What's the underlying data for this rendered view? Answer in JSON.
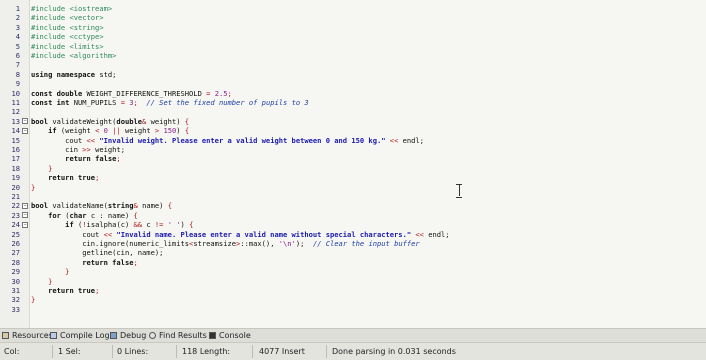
{
  "editor": {
    "lines": [
      {
        "n": "1",
        "fold": "",
        "segs": [
          {
            "c": "dir",
            "t": "#include "
          },
          {
            "c": "inc",
            "t": "<iostream>"
          }
        ]
      },
      {
        "n": "2",
        "fold": "",
        "segs": [
          {
            "c": "dir",
            "t": "#include "
          },
          {
            "c": "inc",
            "t": "<vector>"
          }
        ]
      },
      {
        "n": "3",
        "fold": "",
        "segs": [
          {
            "c": "dir",
            "t": "#include "
          },
          {
            "c": "inc",
            "t": "<string>"
          }
        ]
      },
      {
        "n": "4",
        "fold": "",
        "segs": [
          {
            "c": "dir",
            "t": "#include "
          },
          {
            "c": "inc",
            "t": "<cctype>"
          }
        ]
      },
      {
        "n": "5",
        "fold": "",
        "segs": [
          {
            "c": "dir",
            "t": "#include "
          },
          {
            "c": "inc",
            "t": "<limits>"
          }
        ]
      },
      {
        "n": "6",
        "fold": "",
        "segs": [
          {
            "c": "dir",
            "t": "#include "
          },
          {
            "c": "inc",
            "t": "<algorithm>"
          }
        ]
      },
      {
        "n": "7",
        "fold": "",
        "segs": []
      },
      {
        "n": "8",
        "fold": "",
        "segs": [
          {
            "c": "kw",
            "t": "using namespace "
          },
          {
            "c": "txt",
            "t": "std;"
          }
        ]
      },
      {
        "n": "9",
        "fold": "",
        "segs": []
      },
      {
        "n": "10",
        "fold": "",
        "segs": [
          {
            "c": "kw",
            "t": "const double "
          },
          {
            "c": "txt",
            "t": "WEIGHT_DIFFERENCE_THRESHOLD "
          },
          {
            "c": "sym",
            "t": "="
          },
          {
            "c": "txt",
            "t": " "
          },
          {
            "c": "num",
            "t": "2.5"
          },
          {
            "c": "sym",
            "t": ";"
          }
        ]
      },
      {
        "n": "11",
        "fold": "",
        "segs": [
          {
            "c": "kw",
            "t": "const int "
          },
          {
            "c": "txt",
            "t": "NUM_PUPILS "
          },
          {
            "c": "sym",
            "t": "="
          },
          {
            "c": "txt",
            "t": " "
          },
          {
            "c": "num",
            "t": "3"
          },
          {
            "c": "sym",
            "t": ";"
          },
          {
            "c": "txt",
            "t": "  "
          },
          {
            "c": "cmt",
            "t": "// Set the fixed number of pupils to 3"
          }
        ]
      },
      {
        "n": "12",
        "fold": "",
        "segs": []
      },
      {
        "n": "13",
        "fold": "−",
        "segs": [
          {
            "c": "kw",
            "t": "bool "
          },
          {
            "c": "txt",
            "t": "validateWeight("
          },
          {
            "c": "kw",
            "t": "double"
          },
          {
            "c": "sym",
            "t": "&"
          },
          {
            "c": "txt",
            "t": " weight) "
          },
          {
            "c": "sym",
            "t": "{"
          }
        ]
      },
      {
        "n": "14",
        "fold": "−",
        "segs": [
          {
            "c": "txt",
            "t": "    "
          },
          {
            "c": "kw",
            "t": "if "
          },
          {
            "c": "txt",
            "t": "(weight "
          },
          {
            "c": "sym",
            "t": "<"
          },
          {
            "c": "txt",
            "t": " "
          },
          {
            "c": "num",
            "t": "0"
          },
          {
            "c": "txt",
            "t": " "
          },
          {
            "c": "sym",
            "t": "||"
          },
          {
            "c": "txt",
            "t": " weight "
          },
          {
            "c": "sym",
            "t": ">"
          },
          {
            "c": "txt",
            "t": " "
          },
          {
            "c": "num",
            "t": "150"
          },
          {
            "c": "txt",
            "t": ") "
          },
          {
            "c": "sym",
            "t": "{"
          }
        ]
      },
      {
        "n": "15",
        "fold": "",
        "segs": [
          {
            "c": "txt",
            "t": "        cout "
          },
          {
            "c": "sym",
            "t": "<<"
          },
          {
            "c": "txt",
            "t": " "
          },
          {
            "c": "str",
            "t": "\"Invalid weight. Please enter a valid weight between 0 and 150 kg.\""
          },
          {
            "c": "txt",
            "t": " "
          },
          {
            "c": "sym",
            "t": "<<"
          },
          {
            "c": "txt",
            "t": " endl;"
          }
        ]
      },
      {
        "n": "16",
        "fold": "",
        "segs": [
          {
            "c": "txt",
            "t": "        cin "
          },
          {
            "c": "sym",
            "t": ">>"
          },
          {
            "c": "txt",
            "t": " weight;"
          }
        ]
      },
      {
        "n": "17",
        "fold": "",
        "segs": [
          {
            "c": "txt",
            "t": "        "
          },
          {
            "c": "kw",
            "t": "return false"
          },
          {
            "c": "sym",
            "t": ";"
          }
        ]
      },
      {
        "n": "18",
        "fold": "",
        "segs": [
          {
            "c": "txt",
            "t": "    "
          },
          {
            "c": "sym",
            "t": "}"
          }
        ]
      },
      {
        "n": "19",
        "fold": "",
        "segs": [
          {
            "c": "txt",
            "t": "    "
          },
          {
            "c": "kw",
            "t": "return true"
          },
          {
            "c": "sym",
            "t": ";"
          }
        ]
      },
      {
        "n": "20",
        "fold": "",
        "segs": [
          {
            "c": "sym",
            "t": "}"
          }
        ]
      },
      {
        "n": "21",
        "fold": "",
        "segs": []
      },
      {
        "n": "22",
        "fold": "−",
        "segs": [
          {
            "c": "kw",
            "t": "bool "
          },
          {
            "c": "txt",
            "t": "validateName("
          },
          {
            "c": "kw",
            "t": "string"
          },
          {
            "c": "sym",
            "t": "&"
          },
          {
            "c": "txt",
            "t": " name) "
          },
          {
            "c": "sym",
            "t": "{"
          }
        ]
      },
      {
        "n": "23",
        "fold": "−",
        "segs": [
          {
            "c": "txt",
            "t": "    "
          },
          {
            "c": "kw",
            "t": "for "
          },
          {
            "c": "txt",
            "t": "("
          },
          {
            "c": "kw",
            "t": "char "
          },
          {
            "c": "txt",
            "t": "c : name) "
          },
          {
            "c": "sym",
            "t": "{"
          }
        ]
      },
      {
        "n": "24",
        "fold": "−",
        "segs": [
          {
            "c": "txt",
            "t": "        "
          },
          {
            "c": "kw",
            "t": "if "
          },
          {
            "c": "txt",
            "t": "("
          },
          {
            "c": "sym",
            "t": "!"
          },
          {
            "c": "txt",
            "t": "isalpha(c) "
          },
          {
            "c": "sym",
            "t": "&&"
          },
          {
            "c": "txt",
            "t": " c "
          },
          {
            "c": "sym",
            "t": "!="
          },
          {
            "c": "txt",
            "t": " "
          },
          {
            "c": "num",
            "t": "' '"
          },
          {
            "c": "txt",
            "t": ") "
          },
          {
            "c": "sym",
            "t": "{"
          }
        ]
      },
      {
        "n": "25",
        "fold": "",
        "segs": [
          {
            "c": "txt",
            "t": "            cout "
          },
          {
            "c": "sym",
            "t": "<<"
          },
          {
            "c": "txt",
            "t": " "
          },
          {
            "c": "str",
            "t": "\"Invalid name. Please enter a valid name without special characters.\""
          },
          {
            "c": "txt",
            "t": " "
          },
          {
            "c": "sym",
            "t": "<<"
          },
          {
            "c": "txt",
            "t": " endl;"
          }
        ]
      },
      {
        "n": "26",
        "fold": "",
        "segs": [
          {
            "c": "txt",
            "t": "            cin.ignore(numeric_limits"
          },
          {
            "c": "sym",
            "t": "<"
          },
          {
            "c": "txt",
            "t": "streamsize"
          },
          {
            "c": "sym",
            "t": ">"
          },
          {
            "c": "txt",
            "t": "::max(), "
          },
          {
            "c": "num",
            "t": "'\\n'"
          },
          {
            "c": "txt",
            "t": ");  "
          },
          {
            "c": "cmt",
            "t": "// Clear the input buffer"
          }
        ]
      },
      {
        "n": "27",
        "fold": "",
        "segs": [
          {
            "c": "txt",
            "t": "            getline(cin, name);"
          }
        ]
      },
      {
        "n": "28",
        "fold": "",
        "segs": [
          {
            "c": "txt",
            "t": "            "
          },
          {
            "c": "kw",
            "t": "return false"
          },
          {
            "c": "sym",
            "t": ";"
          }
        ]
      },
      {
        "n": "29",
        "fold": "",
        "segs": [
          {
            "c": "txt",
            "t": "        "
          },
          {
            "c": "sym",
            "t": "}"
          }
        ]
      },
      {
        "n": "30",
        "fold": "",
        "segs": [
          {
            "c": "txt",
            "t": "    "
          },
          {
            "c": "sym",
            "t": "}"
          }
        ]
      },
      {
        "n": "31",
        "fold": "",
        "segs": [
          {
            "c": "txt",
            "t": "    "
          },
          {
            "c": "kw",
            "t": "return true"
          },
          {
            "c": "sym",
            "t": ";"
          }
        ]
      },
      {
        "n": "32",
        "fold": "",
        "segs": [
          {
            "c": "sym",
            "t": "}"
          }
        ]
      },
      {
        "n": "33",
        "fold": "",
        "segs": []
      }
    ]
  },
  "bottom_tabs": [
    {
      "label": "Resources",
      "icon": "resources-icon"
    },
    {
      "label": "Compile Log",
      "icon": "compile-log-icon"
    },
    {
      "label": "Debug",
      "icon": "debug-icon"
    },
    {
      "label": "Find Results",
      "icon": "find-results-icon"
    },
    {
      "label": "Console",
      "icon": "console-icon"
    }
  ],
  "status": {
    "col": "Col:",
    "sel": "1 Sel:",
    "lines": "0 Lines:",
    "length": "118 Length:",
    "insert": "4077 Insert",
    "message": "Done parsing in 0.031 seconds"
  },
  "colors": {
    "editor_bg": "#f6f6f3",
    "keyword": "#101010",
    "string": "#1a1ab0",
    "comment": "#1f3fa8",
    "preprocessor": "#2e8b57",
    "symbol": "#b01818",
    "number": "#8a1f8a"
  }
}
